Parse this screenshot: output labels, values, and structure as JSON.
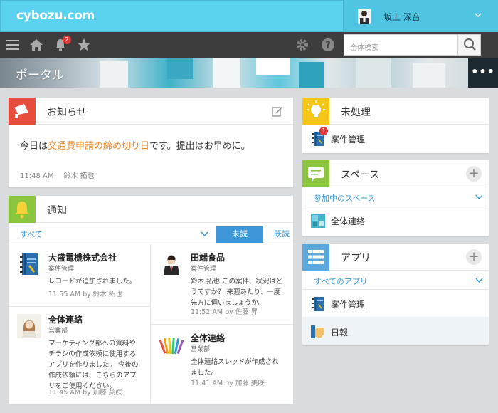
{
  "header": {
    "logo": "cybozu.com",
    "user_name": "坂上 深音"
  },
  "toolbar": {
    "notification_count": "2",
    "search_placeholder": "全体検索",
    "icons": [
      "menu-icon",
      "home-icon",
      "bell-icon",
      "star-icon",
      "gear-icon",
      "help-icon",
      "search-icon"
    ]
  },
  "banner": {
    "title": "ポータル",
    "more": "•••"
  },
  "notice": {
    "title": "お知らせ",
    "text_before": "今日は",
    "text_highlight": "交通費申請の締め切り日",
    "text_after": "です。提出はお早めに。",
    "time": "11:48 AM",
    "author": "鈴木 拓也",
    "highlight_color": "#f08a24"
  },
  "notifications": {
    "title": "通知",
    "filter": "すべて",
    "tab_unread": "未読",
    "tab_read": "既読",
    "items": [
      {
        "name": "大盛電機株式会社",
        "app": "案件管理",
        "msg": "レコードが追加されました。",
        "time": "11:55 AM  by 鈴木 拓也"
      },
      {
        "name": "田端食品",
        "app": "案件管理",
        "msg": "鈴木 拓也 この案件、状況はどうですか？ 来週あたり、一度先方に伺いましょうか。",
        "time": "11:52 AM  by 佐藤 昇"
      },
      {
        "name": "全体連絡",
        "app": "営業部",
        "msg": "マーケティング部への資料やチラシの作成依頼に使用するアプリを作りました。 今後の作成依頼には、こちらのアプリをご使用ください。",
        "time": "11:45 AM  by 加藤 美咲"
      },
      {
        "name": "全体連絡",
        "app": "営業部",
        "msg": "全体連絡スレッドが作成されました。",
        "time": "11:41 AM  by 加藤 美咲"
      }
    ]
  },
  "pending": {
    "title": "未処理",
    "items": [
      {
        "label": "案件管理",
        "badge": "1"
      }
    ]
  },
  "space": {
    "title": "スペース",
    "filter": "参加中のスペース",
    "items": [
      {
        "label": "全体連絡"
      }
    ]
  },
  "apps": {
    "title": "アプリ",
    "filter": "すべてのアプリ",
    "items": [
      {
        "label": "案件管理"
      },
      {
        "label": "日報"
      }
    ]
  },
  "colors": {
    "header": "#5bd2ef",
    "toolbar": "#3d3d3d",
    "notice_icon": "#e74c3c",
    "notification_icon": "#8cc63f",
    "pending_icon": "#f5c518",
    "space_icon": "#8cc63f",
    "apps_icon": "#5aa8de",
    "link": "#3498db"
  }
}
